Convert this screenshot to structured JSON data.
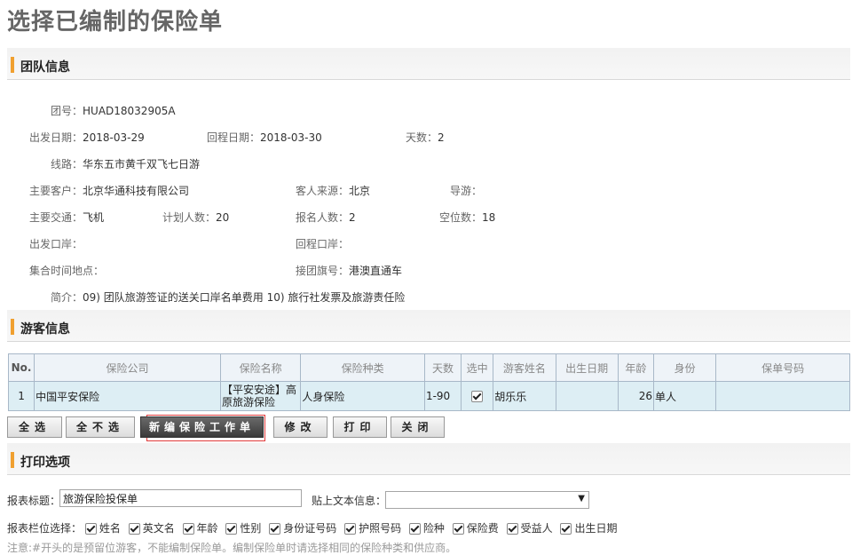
{
  "page_title": "选择已编制的保险单",
  "sections": {
    "team": "团队信息",
    "guests": "游客信息",
    "print": "打印选项"
  },
  "team_info": {
    "group_no_label": "团号：",
    "group_no": "HUAD18032905A",
    "depart_label": "出发日期：",
    "depart": "2018-03-29",
    "return_label": "回程日期：",
    "return": "2018-03-30",
    "days_label": "天数：",
    "days": "2",
    "route_label": "线路：",
    "route": "华东五市黄千双飞七日游",
    "client_label": "主要客户：",
    "client": "北京华通科技有限公司",
    "source_label": "客人来源：",
    "source": "北京",
    "guide_label": "导游：",
    "guide": "",
    "transport_label": "主要交通：",
    "transport": "飞机",
    "planned_label": "计划人数：",
    "planned": "20",
    "signed_label": "报名人数：",
    "signed": "2",
    "vacant_label": "空位数：",
    "vacant": "18",
    "depart_port_label": "出发口岸：",
    "depart_port": "",
    "return_port_label": "回程口岸：",
    "return_port": "",
    "meet_label": "集合时间地点：",
    "meet": "",
    "flag_label": "接团旗号：",
    "flag": "港澳直通车",
    "summary_label": "简介：",
    "summary": "09) 团队旅游签证的送关口岸名单费用 10) 旅行社发票及旅游责任险"
  },
  "guest_table": {
    "headers": [
      "No.",
      "保险公司",
      "保险名称",
      "保险种类",
      "天数",
      "选中",
      "游客姓名",
      "出生日期",
      "年龄",
      "身份",
      "保单号码"
    ],
    "rows": [
      {
        "no": "1",
        "company": "中国平安保险",
        "name": "【平安安途】高原旅游保险",
        "type": "人身保险",
        "days": "1-90",
        "selected": true,
        "guest": "胡乐乐",
        "birth": "",
        "age": "26",
        "identity": "单人",
        "policy": ""
      }
    ]
  },
  "buttons": {
    "select_all": "全选",
    "select_none": "全不选",
    "new_sheet": "新编保险工作单",
    "edit": "修改",
    "print": "打印",
    "close": "关闭"
  },
  "print_options": {
    "title_label": "报表标题：",
    "title_value": "旅游保险投保单",
    "paste_label": "贴上文本信息：",
    "paste_value": "",
    "columns_label": "报表栏位选择：",
    "columns": [
      "姓名",
      "英文名",
      "年龄",
      "性别",
      "身份证号码",
      "护照号码",
      "险种",
      "保险费",
      "受益人",
      "出生日期"
    ],
    "note": "注意:#开头的是预留位游客，不能编制保险单。编制保险单时请选择相同的保险种类和供应商。"
  },
  "colors": {
    "accent": "#f0a030",
    "table_row": "#ddeef4",
    "highlight": "#e03a3a"
  },
  "icons": [
    "pointer-arrow-icon",
    "dropdown-arrow-icon",
    "checkbox-icon"
  ]
}
